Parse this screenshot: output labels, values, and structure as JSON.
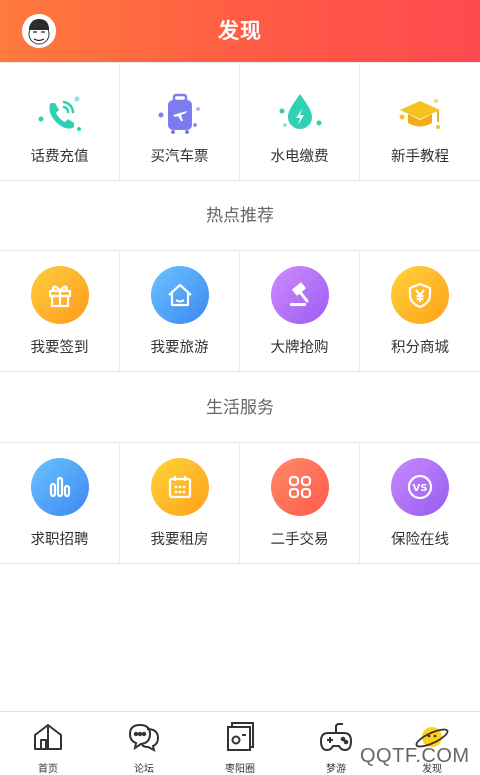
{
  "header": {
    "title": "发现",
    "background_from": "#ff7a3c",
    "background_to": "#ff4a4f"
  },
  "quick_actions": [
    {
      "label": "话费充值",
      "icon": "phone-icon",
      "color": "#2fd0b4"
    },
    {
      "label": "买汽车票",
      "icon": "luggage-icon",
      "color": "#7b7cf0"
    },
    {
      "label": "水电缴费",
      "icon": "water-drop-icon",
      "color": "#2fd0b4"
    },
    {
      "label": "新手教程",
      "icon": "graduation-cap-icon",
      "color": "#f7c21e"
    }
  ],
  "sections": [
    {
      "title": "热点推荐",
      "items": [
        {
          "label": "我要签到",
          "icon": "gift-icon",
          "color": "#ffb22a"
        },
        {
          "label": "我要旅游",
          "icon": "house-icon",
          "color": "#4a9cf5"
        },
        {
          "label": "大牌抢购",
          "icon": "auction-hammer-icon",
          "color": "#b574f0"
        },
        {
          "label": "积分商城",
          "icon": "yuan-shield-icon",
          "color": "#ffb51c"
        }
      ]
    },
    {
      "title": "生活服务",
      "items": [
        {
          "label": "求职招聘",
          "icon": "bar-chart-icon",
          "color": "#4a9cf5"
        },
        {
          "label": "我要租房",
          "icon": "calendar-icon",
          "color": "#ffb51c"
        },
        {
          "label": "二手交易",
          "icon": "apps-grid-icon",
          "color": "#ff6a55"
        },
        {
          "label": "保险在线",
          "icon": "vs-badge-icon",
          "color": "#a468f0"
        }
      ]
    }
  ],
  "tabbar": [
    {
      "label": "首页",
      "icon": "home-icon"
    },
    {
      "label": "论坛",
      "icon": "chat-bubbles-icon"
    },
    {
      "label": "枣阳圈",
      "icon": "circle-frame-icon"
    },
    {
      "label": "梦游",
      "icon": "gamepad-icon"
    },
    {
      "label": "发现",
      "icon": "planet-icon"
    }
  ],
  "watermark": "QQTF.COM"
}
